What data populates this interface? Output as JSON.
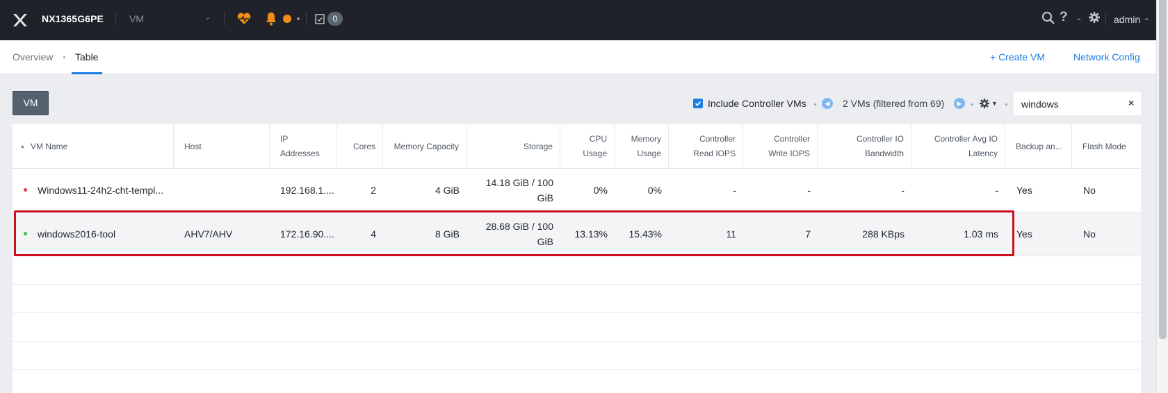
{
  "topbar": {
    "cluster_name": "NX1365G6PE",
    "entity_selector": "VM",
    "task_count": "0",
    "user": "admin"
  },
  "subnav": {
    "tabs": [
      {
        "label": "Overview",
        "active": false
      },
      {
        "label": "Table",
        "active": true
      }
    ],
    "create_vm": "+  Create VM",
    "network_config": "Network Config"
  },
  "toolbar": {
    "vm_button": "VM",
    "include_controller_label": "Include Controller VMs",
    "include_controller_checked": true,
    "pager_text": "2 VMs (filtered from 69)",
    "search_value": "windows",
    "search_clear": "×"
  },
  "table": {
    "columns": [
      "VM Name",
      "Host",
      "IP Addresses",
      "Cores",
      "Memory Capacity",
      "Storage",
      "CPU Usage",
      "Memory Usage",
      "Controller Read IOPS",
      "Controller Write IOPS",
      "Controller IO Bandwidth",
      "Controller Avg IO Latency",
      "Backup an...",
      "Flash Mode"
    ],
    "rows": [
      {
        "status": "off",
        "status_color": "#e0404a",
        "name": "Windows11-24h2-cht-templ...",
        "host": "",
        "ip": "192.168.1....",
        "cores": "2",
        "memory": "4 GiB",
        "storage": "14.18 GiB / 100 GiB",
        "cpu": "0%",
        "mem_usage": "0%",
        "read_iops": "-",
        "write_iops": "-",
        "io_bw": "-",
        "io_latency": "-",
        "backup": "Yes",
        "flash": "No"
      },
      {
        "status": "on",
        "status_color": "#3fb950",
        "name": "windows2016-tool",
        "host": "AHV7/AHV",
        "ip": "172.16.90....",
        "cores": "4",
        "memory": "8 GiB",
        "storage": "28.68 GiB / 100 GiB",
        "cpu": "13.13%",
        "mem_usage": "15.43%",
        "read_iops": "11",
        "write_iops": "7",
        "io_bw": "288 KBps",
        "io_latency": "1.03 ms",
        "backup": "Yes",
        "flash": "No"
      }
    ]
  },
  "colors": {
    "accent": "#1a7ee0",
    "highlight": "#cc0e1e",
    "topbar": "#1f2329",
    "alert": "#f08c14"
  }
}
